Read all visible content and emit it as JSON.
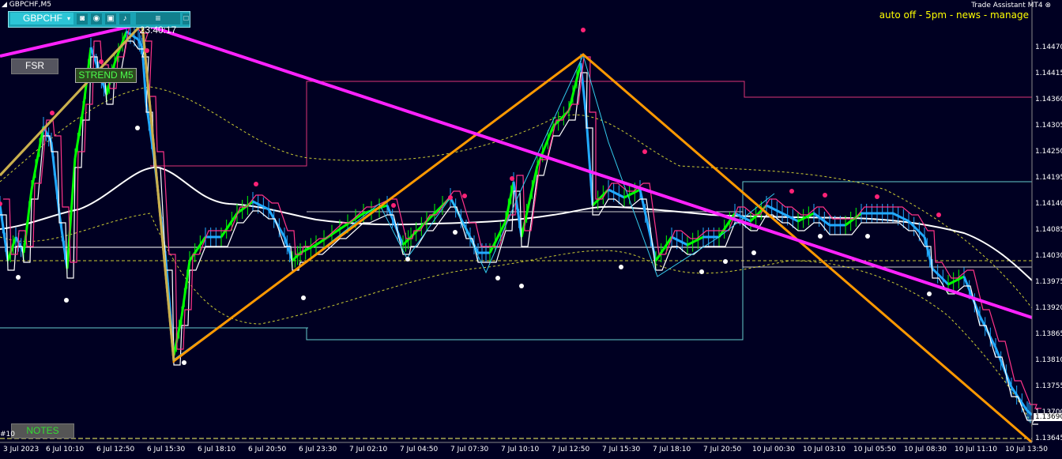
{
  "window": {
    "title": "GBPCHF,M5"
  },
  "toolbar": {
    "symbol": "GBPCHF",
    "time": "23:40:17"
  },
  "assistant": {
    "title": "Trade Assistant MT4",
    "status": "auto off - 5pm - news - manage"
  },
  "buttons": {
    "fsr": "FSR",
    "strend": "STREND M5",
    "notes": "NOTES"
  },
  "left_edge_label": "#10",
  "price_axis": {
    "labels": [
      "1.14470",
      "1.14415",
      "1.14360",
      "1.14305",
      "1.14250",
      "1.14195",
      "1.14140",
      "1.14085",
      "1.14030",
      "1.13975",
      "1.13920",
      "1.13865",
      "1.13810",
      "1.13755",
      "1.13700",
      "1.13645"
    ],
    "current_price": "1.13690"
  },
  "time_axis": {
    "labels": [
      "3 Jul 2023",
      "6 Jul 10:10",
      "6 Jul 12:50",
      "6 Jul 15:30",
      "6 Jul 18:10",
      "6 Jul 20:50",
      "6 Jul 23:30",
      "7 Jul 02:10",
      "7 Jul 04:50",
      "7 Jul 07:30",
      "7 Jul 10:10",
      "7 Jul 12:50",
      "7 Jul 15:30",
      "7 Jul 18:10",
      "7 Jul 20:50",
      "10 Jul 00:30",
      "10 Jul 03:10",
      "10 Jul 05:50",
      "10 Jul 08:30",
      "10 Jul 11:10",
      "10 Jul 13:50"
    ]
  },
  "colors": {
    "background": "#000022",
    "zigzag_major": "#ff9900",
    "trendline": "#ff22ff",
    "bull": "#00ff00",
    "bear": "#22aaff",
    "marker_top": "#ff2277",
    "marker_bottom": "#ffffff"
  }
}
